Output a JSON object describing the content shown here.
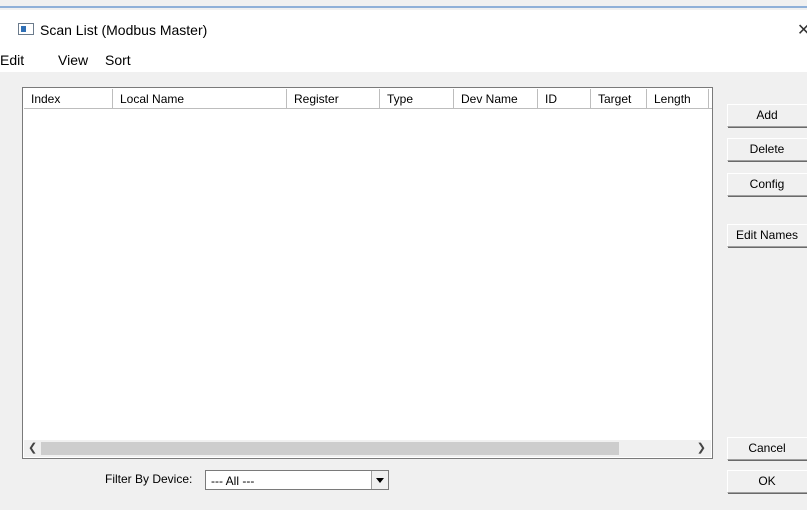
{
  "window": {
    "title": "Scan List (Modbus Master)"
  },
  "menu": [
    "Edit",
    "View",
    "Sort"
  ],
  "table": {
    "columns": [
      "Index",
      "Local Name",
      "Register",
      "Type",
      "Dev Name",
      "ID",
      "Target",
      "Length"
    ],
    "rows": []
  },
  "buttons": {
    "add": "Add",
    "delete": "Delete",
    "config": "Config",
    "edit_names": "Edit Names",
    "cancel": "Cancel",
    "ok": "OK"
  },
  "filter": {
    "label": "Filter By Device:",
    "value": "--- All ---"
  },
  "icons": [
    "app-window-icon",
    "close-icon",
    "scroll-left-icon",
    "scroll-right-icon",
    "dropdown-arrow-icon"
  ]
}
